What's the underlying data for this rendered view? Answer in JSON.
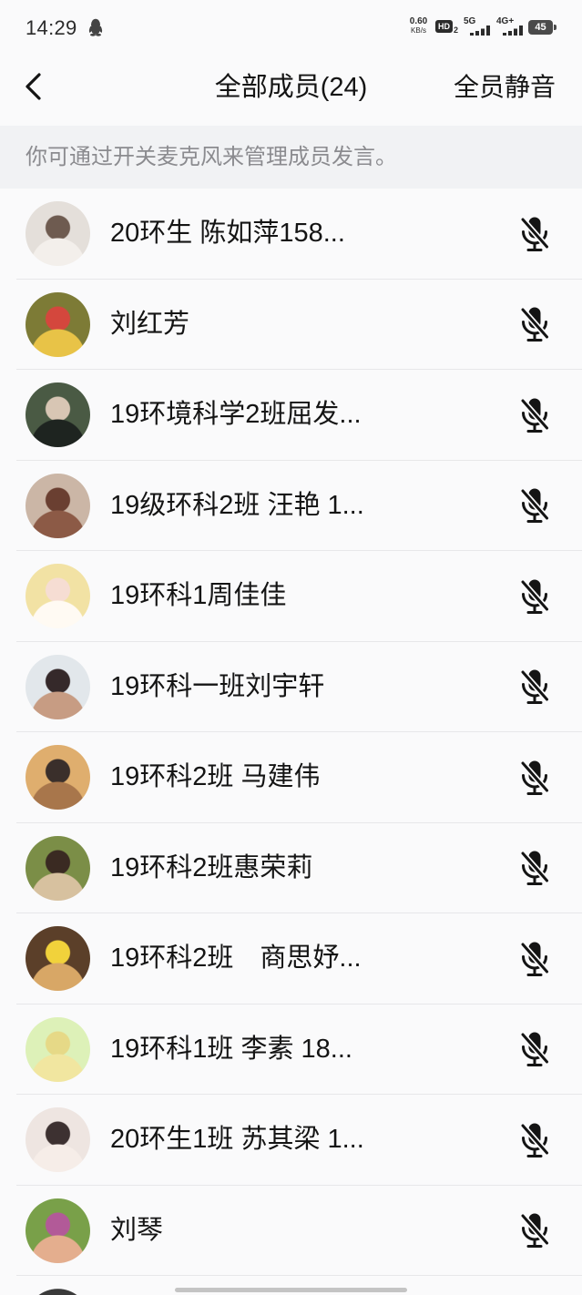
{
  "colors": {
    "page_bg": "#fafafb",
    "hint_bg": "#f1f2f4",
    "text_primary": "#141414",
    "text_secondary": "#8b8b8f",
    "divider": "#e7e7e9",
    "icon": "#141414",
    "status_text": "#2b2b2b"
  },
  "status_bar": {
    "time": "14:29",
    "notification_icon": "qq-penguin-icon",
    "net_speed_value": "0.60",
    "net_speed_unit": "KB/s",
    "hd_label": "HD",
    "hd_index": "2",
    "sim1_network": "5G",
    "sim1_signal": 4,
    "sim2_network": "4G+",
    "sim2_signal": 4,
    "battery_level": "45"
  },
  "header": {
    "back_icon": "chevron-left-icon",
    "title": "全部成员(24)",
    "mute_all_label": "全员静音"
  },
  "hint": {
    "text": "你可通过开关麦克风来管理成员发言。"
  },
  "members": [
    {
      "name": "20环生 陈如萍158...",
      "mic_icon": "mic-muted-icon",
      "avatar_colors": [
        "#e4dfda",
        "#f3efeb",
        "#6e5b50"
      ]
    },
    {
      "name": "刘红芳",
      "mic_icon": "mic-muted-icon",
      "avatar_colors": [
        "#7d7b36",
        "#e8c347",
        "#d4473d"
      ]
    },
    {
      "name": "19环境科学2班屈发...",
      "mic_icon": "mic-muted-icon",
      "avatar_colors": [
        "#4a5a44",
        "#1e2420",
        "#d8c6b4"
      ]
    },
    {
      "name": "19级环科2班 汪艳 1...",
      "mic_icon": "mic-muted-icon",
      "avatar_colors": [
        "#cbb6a6",
        "#8c5a46",
        "#6a3f31"
      ]
    },
    {
      "name": "19环科1周佳佳",
      "mic_icon": "mic-muted-icon",
      "avatar_colors": [
        "#f2e2a4",
        "#fffaf3",
        "#f6ddd3"
      ]
    },
    {
      "name": "19环科一班刘宇轩",
      "mic_icon": "mic-muted-icon",
      "avatar_colors": [
        "#e2e7eb",
        "#c79c83",
        "#35292a"
      ]
    },
    {
      "name": "19环科2班 马建伟",
      "mic_icon": "mic-muted-icon",
      "avatar_colors": [
        "#dfae6e",
        "#a8764b",
        "#3a2f2b"
      ]
    },
    {
      "name": "19环科2班惠荣莉",
      "mic_icon": "mic-muted-icon",
      "avatar_colors": [
        "#7b8e47",
        "#d7c19f",
        "#3a2a22"
      ]
    },
    {
      "name": "19环科2班　商思妤...",
      "mic_icon": "mic-muted-icon",
      "avatar_colors": [
        "#5b3f29",
        "#d8a766",
        "#f1d23b"
      ]
    },
    {
      "name": "19环科1班 李素 18...",
      "mic_icon": "mic-muted-icon",
      "avatar_colors": [
        "#ddf1b8",
        "#f1e6a0",
        "#e6d987"
      ]
    },
    {
      "name": "20环生1班 苏其梁 1...",
      "mic_icon": "mic-muted-icon",
      "avatar_colors": [
        "#eee5e1",
        "#f6ede8",
        "#3d3131"
      ]
    },
    {
      "name": "刘琴",
      "mic_icon": "mic-muted-icon",
      "avatar_colors": [
        "#79a049",
        "#e4ae8e",
        "#b25a98"
      ]
    }
  ]
}
